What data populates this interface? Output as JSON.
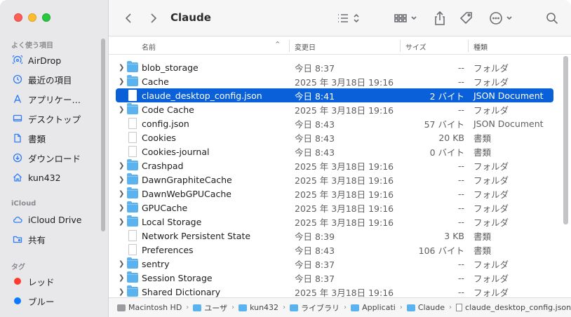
{
  "window": {
    "title": "Claude"
  },
  "sidebar": {
    "favorites_header": "よく使う項目",
    "favorites": [
      {
        "label": "AirDrop",
        "icon": "airdrop-icon"
      },
      {
        "label": "最近の項目",
        "icon": "clock-icon"
      },
      {
        "label": "アプリケー…",
        "icon": "applications-icon"
      },
      {
        "label": "デスクトップ",
        "icon": "desktop-icon"
      },
      {
        "label": "書類",
        "icon": "document-icon"
      },
      {
        "label": "ダウンロード",
        "icon": "download-icon"
      },
      {
        "label": "kun432",
        "icon": "home-icon"
      }
    ],
    "icloud_header": "iCloud",
    "icloud": [
      {
        "label": "iCloud Drive",
        "icon": "cloud-icon"
      },
      {
        "label": "共有",
        "icon": "shared-folder-icon"
      }
    ],
    "tags_header": "タグ",
    "tags": [
      {
        "label": "レッド",
        "color": "#ff3b30"
      },
      {
        "label": "ブルー",
        "color": "#0a7aff"
      }
    ]
  },
  "columns": {
    "name": "名前",
    "date": "変更日",
    "size": "サイズ",
    "kind": "種類"
  },
  "files": [
    {
      "name": "blob_storage",
      "date": "今日 8:37",
      "size": "--",
      "kind": "フォルダ",
      "type": "folder"
    },
    {
      "name": "Cache",
      "date": "2025 年 3月18日 19:16",
      "size": "--",
      "kind": "フォルダ",
      "type": "folder"
    },
    {
      "name": "claude_desktop_config.json",
      "date": "今日 8:41",
      "size": "2 バイト",
      "kind": "JSON Document",
      "type": "file",
      "selected": true
    },
    {
      "name": "Code Cache",
      "date": "2025 年 3月18日 19:16",
      "size": "--",
      "kind": "フォルダ",
      "type": "folder"
    },
    {
      "name": "config.json",
      "date": "今日 8:43",
      "size": "57 バイト",
      "kind": "JSON Document",
      "type": "file"
    },
    {
      "name": "Cookies",
      "date": "今日 8:43",
      "size": "20 KB",
      "kind": "書類",
      "type": "file"
    },
    {
      "name": "Cookies-journal",
      "date": "今日 8:43",
      "size": "0 バイト",
      "kind": "書類",
      "type": "file"
    },
    {
      "name": "Crashpad",
      "date": "2025 年 3月18日 19:16",
      "size": "--",
      "kind": "フォルダ",
      "type": "folder"
    },
    {
      "name": "DawnGraphiteCache",
      "date": "2025 年 3月18日 19:16",
      "size": "--",
      "kind": "フォルダ",
      "type": "folder"
    },
    {
      "name": "DawnWebGPUCache",
      "date": "2025 年 3月18日 19:16",
      "size": "--",
      "kind": "フォルダ",
      "type": "folder"
    },
    {
      "name": "GPUCache",
      "date": "2025 年 3月18日 19:16",
      "size": "--",
      "kind": "フォルダ",
      "type": "folder"
    },
    {
      "name": "Local Storage",
      "date": "2025 年 3月18日 19:16",
      "size": "--",
      "kind": "フォルダ",
      "type": "folder"
    },
    {
      "name": "Network Persistent State",
      "date": "今日 8:39",
      "size": "3 KB",
      "kind": "書類",
      "type": "file"
    },
    {
      "name": "Preferences",
      "date": "今日 8:43",
      "size": "106 バイト",
      "kind": "書類",
      "type": "file"
    },
    {
      "name": "sentry",
      "date": "今日 8:37",
      "size": "--",
      "kind": "フォルダ",
      "type": "folder"
    },
    {
      "name": "Session Storage",
      "date": "今日 8:37",
      "size": "--",
      "kind": "フォルダ",
      "type": "folder"
    },
    {
      "name": "Shared Dictionary",
      "date": "2025 年 3月18日 19:16",
      "size": "--",
      "kind": "フォルダ",
      "type": "folder"
    }
  ],
  "pathbar": [
    {
      "label": "Macintosh HD",
      "icon": "disk"
    },
    {
      "label": "ユーザ",
      "icon": "fold"
    },
    {
      "label": "kun432",
      "icon": "fold"
    },
    {
      "label": "ライブラリ",
      "icon": "fold"
    },
    {
      "label": "Applicati",
      "icon": "fold"
    },
    {
      "label": "Claude",
      "icon": "fold"
    },
    {
      "label": "claude_desktop_config.json",
      "icon": "doc"
    }
  ]
}
